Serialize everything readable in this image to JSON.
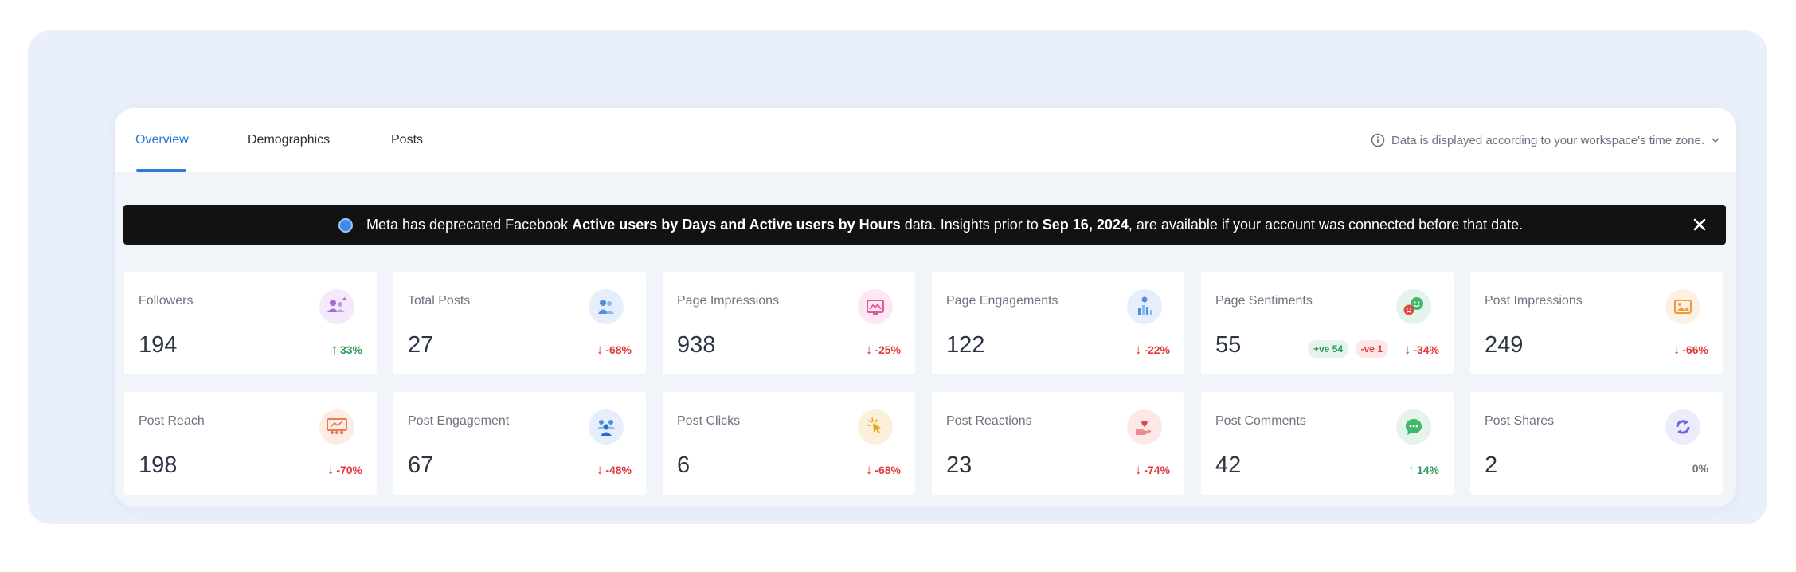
{
  "tabs": [
    {
      "label": "Overview",
      "active": true
    },
    {
      "label": "Demographics",
      "active": false
    },
    {
      "label": "Posts",
      "active": false
    }
  ],
  "timezone_note": "Data is displayed according to your workspace's time zone.",
  "banner": {
    "part1": "Meta has deprecated Facebook ",
    "bold1": "Active users by Days and Active users by Hours",
    "part2": " data. Insights prior to ",
    "bold2": "Sep 16, 2024",
    "part3": ", are available if your account was connected before that date."
  },
  "colors": {
    "accent": "#2d7ad6",
    "up": "#2f9a5c",
    "down": "#e2393d",
    "banner_bg": "#121212"
  },
  "cards": [
    {
      "label": "Followers",
      "value": "194",
      "change": "33%",
      "direction": "up",
      "icon": "followers-icon"
    },
    {
      "label": "Total Posts",
      "value": "27",
      "change": "-68%",
      "direction": "down",
      "icon": "posts-icon"
    },
    {
      "label": "Page Impressions",
      "value": "938",
      "change": "-25%",
      "direction": "down",
      "icon": "impressions-icon"
    },
    {
      "label": "Page Engagements",
      "value": "122",
      "change": "-22%",
      "direction": "down",
      "icon": "engagement-chart-icon"
    },
    {
      "label": "Page Sentiments",
      "value": "55",
      "change": "-34%",
      "direction": "down",
      "icon": "sentiment-faces-icon",
      "positive": "+ve 54",
      "negative": "-ve 1"
    },
    {
      "label": "Post Impressions",
      "value": "249",
      "change": "-66%",
      "direction": "down",
      "icon": "image-post-icon"
    },
    {
      "label": "Post Reach",
      "value": "198",
      "change": "-70%",
      "direction": "down",
      "icon": "audience-screen-icon"
    },
    {
      "label": "Post Engagement",
      "value": "67",
      "change": "-48%",
      "direction": "down",
      "icon": "group-icon"
    },
    {
      "label": "Post Clicks",
      "value": "6",
      "change": "-68%",
      "direction": "down",
      "icon": "click-icon"
    },
    {
      "label": "Post Reactions",
      "value": "23",
      "change": "-74%",
      "direction": "down",
      "icon": "heart-hand-icon"
    },
    {
      "label": "Post Comments",
      "value": "42",
      "change": "14%",
      "direction": "up",
      "icon": "comment-icon"
    },
    {
      "label": "Post Shares",
      "value": "2",
      "change": "0%",
      "direction": "flat",
      "icon": "share-cycle-icon"
    }
  ]
}
